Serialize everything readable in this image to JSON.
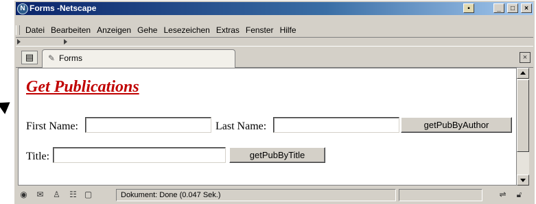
{
  "window": {
    "title": "Forms -Netscape",
    "controls": [
      "minimize",
      "maximize",
      "close"
    ]
  },
  "menu": {
    "items": [
      "Datei",
      "Bearbeiten",
      "Anzeigen",
      "Gehe",
      "Lesezeichen",
      "Extras",
      "Fenster",
      "Hilfe"
    ]
  },
  "tabs": {
    "active_label": "Forms"
  },
  "page": {
    "heading": "Get Publications",
    "first_name_label": "First Name:",
    "first_name_value": "",
    "last_name_label": "Last Name:",
    "last_name_value": "",
    "author_button": "getPubByAuthor",
    "title_label": "Title:",
    "title_value": "",
    "title_button": "getPubByTitle"
  },
  "status": {
    "text": "Dokument: Done (0.047 Sek.)"
  },
  "colors": {
    "heading": "#c00000",
    "titlebar_start": "#0a246a",
    "titlebar_end": "#a6caf0",
    "chrome": "#d4d0c8"
  }
}
